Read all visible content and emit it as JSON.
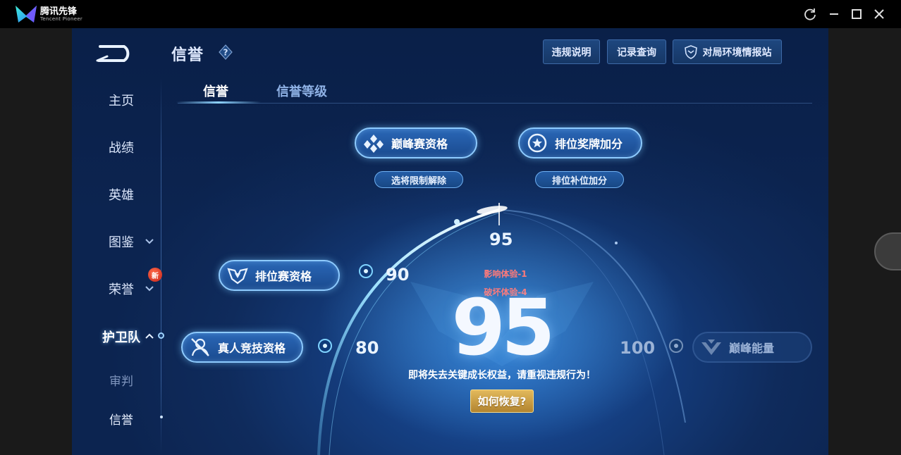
{
  "titlebar": {
    "app_name": "腾讯先锋",
    "app_subtitle": "Tencent Pioneer"
  },
  "header": {
    "title": "信誉",
    "buttons": [
      {
        "label": "违规说明"
      },
      {
        "label": "记录查询"
      },
      {
        "label": "对局环境情报站"
      }
    ]
  },
  "sidebar": {
    "items": [
      {
        "label": "主页"
      },
      {
        "label": "战绩"
      },
      {
        "label": "英雄"
      },
      {
        "label": "图鉴"
      },
      {
        "label": "荣誉"
      },
      {
        "label": "护卫队"
      },
      {
        "label": "审判"
      },
      {
        "label": "信誉"
      }
    ],
    "new_badge": "新"
  },
  "tabs": [
    {
      "label": "信誉",
      "active": true
    },
    {
      "label": "信誉等级",
      "active": false
    }
  ],
  "privileges": {
    "peak_qualification": "巅峰赛资格",
    "ranked_medal_bonus": "排位奖牌加分",
    "hero_pick_unlock": "选将限制解除",
    "ranked_fill_bonus": "排位补位加分",
    "ranked_qualification": "排位赛资格",
    "live_competition_qualification": "真人竞技资格",
    "peak_energy": "巅峰能量"
  },
  "score": {
    "current": 95,
    "marker_label": "95",
    "ticks": [
      "80",
      "90",
      "100"
    ],
    "impacts": [
      "影响体验-1",
      "破坏体验-4"
    ],
    "warning": "即将失去关键成长权益，请重视违规行为！",
    "recover_button": "如何恢复?"
  },
  "colors": {
    "accent": "#8ecbff",
    "background": "#153f82",
    "warning_red": "#ff7a7a",
    "gold": "#e2b95c"
  }
}
